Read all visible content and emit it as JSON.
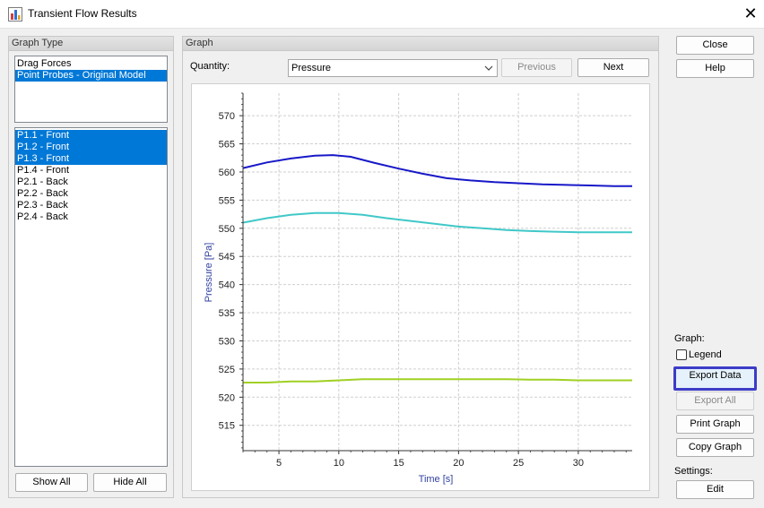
{
  "window": {
    "title": "Transient Flow Results",
    "close_glyph": "✕"
  },
  "graph_type_panel": {
    "header": "Graph Type",
    "types": [
      {
        "label": "Drag Forces",
        "selected": false
      },
      {
        "label": "Point Probes - Original Model",
        "selected": true
      }
    ],
    "probes": [
      {
        "label": "P1.1 - Front",
        "selected": true
      },
      {
        "label": "P1.2 - Front",
        "selected": true
      },
      {
        "label": "P1.3 - Front",
        "selected": true
      },
      {
        "label": "P1.4 - Front",
        "selected": false
      },
      {
        "label": "P2.1 - Back",
        "selected": false
      },
      {
        "label": "P2.2 - Back",
        "selected": false
      },
      {
        "label": "P2.3 - Back",
        "selected": false
      },
      {
        "label": "P2.4 - Back",
        "selected": false
      }
    ],
    "show_all_label": "Show All",
    "hide_all_label": "Hide All"
  },
  "graph_panel": {
    "header": "Graph",
    "quantity_label": "Quantity:",
    "quantity_value": "Pressure",
    "previous_label": "Previous",
    "next_label": "Next"
  },
  "side_panel": {
    "close_label": "Close",
    "help_label": "Help",
    "graph_section_label": "Graph:",
    "legend_label": "Legend",
    "legend_checked": false,
    "export_data_label": "Export Data",
    "export_all_label": "Export All",
    "print_graph_label": "Print Graph",
    "copy_graph_label": "Copy Graph",
    "settings_label": "Settings:",
    "edit_label": "Edit"
  },
  "chart_data": {
    "type": "line",
    "title": "",
    "xlabel": "Time [s]",
    "ylabel": "Pressure [Pa]",
    "xlim": [
      2,
      34.5
    ],
    "ylim": [
      510.5,
      574
    ],
    "xticks": [
      5,
      10,
      15,
      20,
      25,
      30
    ],
    "yticks": [
      515,
      520,
      525,
      530,
      535,
      540,
      545,
      550,
      555,
      560,
      565,
      570
    ],
    "grid": true,
    "series": [
      {
        "color": "#1818c8",
        "x": [
          2,
          4,
          6,
          8,
          9.5,
          11,
          13,
          15,
          17,
          19,
          21,
          23,
          25,
          27,
          29,
          31,
          33,
          34.5
        ],
        "y": [
          560.7,
          561.7,
          562.4,
          562.9,
          563.0,
          562.7,
          561.6,
          560.6,
          559.7,
          558.9,
          558.5,
          558.2,
          558.0,
          557.8,
          557.7,
          557.6,
          557.5,
          557.5
        ]
      },
      {
        "color": "#40c8c8",
        "x": [
          2,
          4,
          6,
          8,
          10,
          12,
          14,
          16,
          18,
          20,
          22,
          24,
          26,
          28,
          30,
          32,
          34.5
        ],
        "y": [
          551.0,
          551.8,
          552.4,
          552.7,
          552.7,
          552.4,
          551.8,
          551.3,
          550.8,
          550.3,
          550.0,
          549.7,
          549.5,
          549.4,
          549.3,
          549.3,
          549.3
        ]
      },
      {
        "color": "#a0d022",
        "x": [
          2,
          4,
          6,
          8,
          10,
          12,
          14,
          16,
          18,
          20,
          22,
          24,
          26,
          28,
          30,
          32,
          34.5
        ],
        "y": [
          522.6,
          522.6,
          522.8,
          522.8,
          523.0,
          523.2,
          523.2,
          523.2,
          523.2,
          523.2,
          523.2,
          523.2,
          523.1,
          523.1,
          523.0,
          523.0,
          523.0
        ]
      }
    ]
  }
}
